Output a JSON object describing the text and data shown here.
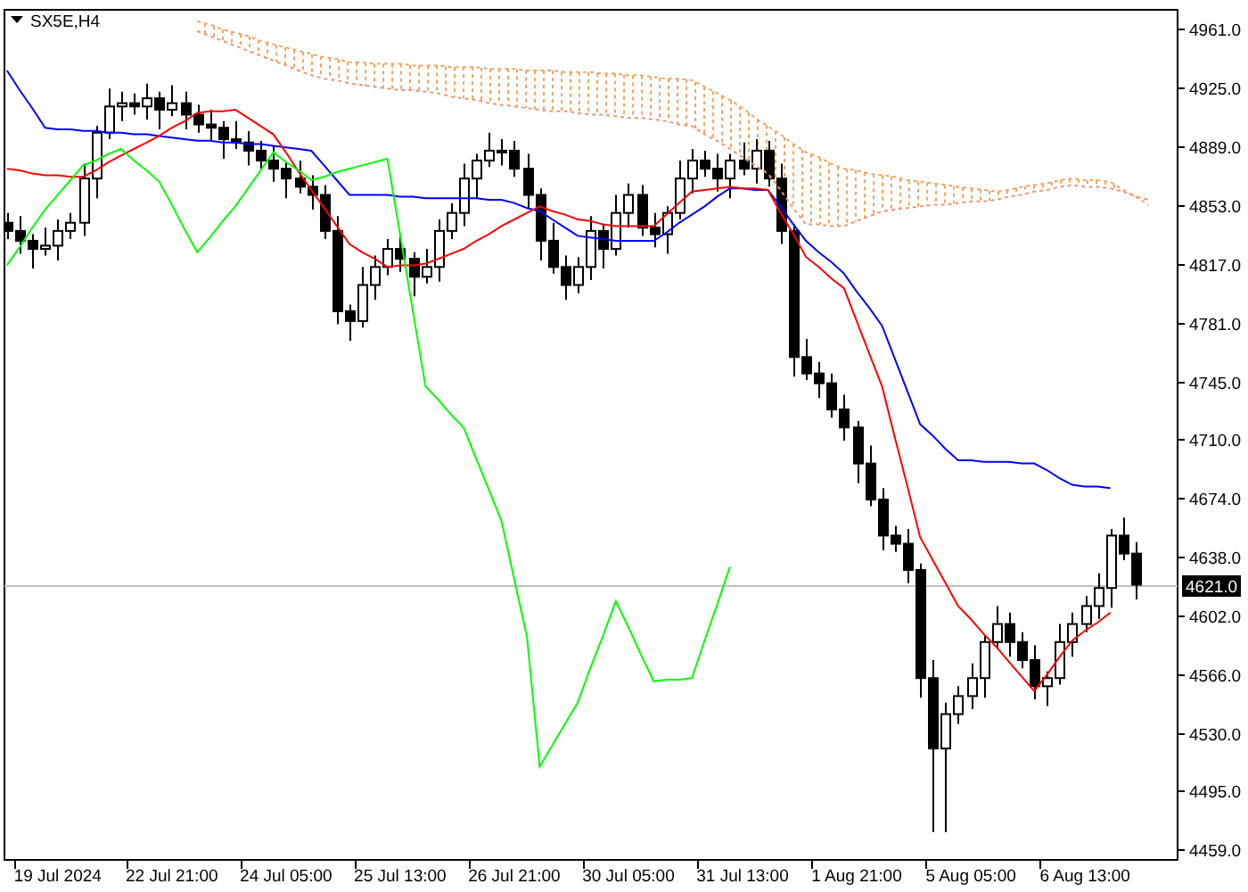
{
  "chart": {
    "symbol": "SX5E,H4",
    "chart_data": {
      "type": "candlestick",
      "categories": [
        null,
        null,
        null,
        null,
        "19 Jul 2024",
        null,
        null,
        null,
        null,
        null,
        null,
        null,
        null,
        "22 Jul 21:00",
        null,
        null,
        null,
        null,
        null,
        null,
        null,
        null,
        "24 Jul 05:00",
        null,
        null,
        null,
        null,
        null,
        null,
        null,
        null,
        "25 Jul 13:00",
        null,
        null,
        null,
        null,
        null,
        null,
        null,
        null,
        "26 Jul 21:00",
        null,
        null,
        null,
        null,
        null,
        null,
        null,
        null,
        "30 Jul 05:00",
        null,
        null,
        null,
        null,
        null,
        null,
        null,
        null,
        "31 Jul 13:00",
        null,
        null,
        null,
        null,
        null,
        null,
        null,
        null,
        "1 Aug 21:00",
        null,
        null,
        null,
        null,
        null,
        null,
        null,
        null,
        "5 Aug 05:00",
        null,
        null,
        null,
        null,
        null,
        null,
        null,
        null,
        "6 Aug 13:00",
        null,
        null,
        null,
        null,
        null
      ],
      "ylim": [
        4453,
        4972
      ],
      "ref_lines": [
        {
          "axis": "y",
          "value": 4621,
          "label": "4621.0",
          "color": "#c0c0c0"
        }
      ],
      "yticks": [
        {
          "value": 4961,
          "label": "4961.0"
        },
        {
          "value": 4925,
          "label": "4925.0"
        },
        {
          "value": 4889,
          "label": "4889.0"
        },
        {
          "value": 4853,
          "label": "4853.0"
        },
        {
          "value": 4817,
          "label": "4817.0"
        },
        {
          "value": 4781,
          "label": "4781.0"
        },
        {
          "value": 4745,
          "label": "4745.0"
        },
        {
          "value": 4710,
          "label": "4710.0"
        },
        {
          "value": 4674,
          "label": "4674.0"
        },
        {
          "value": 4638,
          "label": "4638.0"
        },
        {
          "value": 4602,
          "label": "4602.0"
        },
        {
          "value": 4566,
          "label": "4566.0"
        },
        {
          "value": 4530,
          "label": "4530.0"
        },
        {
          "value": 4495,
          "label": "4495.0"
        },
        {
          "value": 4459,
          "label": "4459.0"
        }
      ],
      "ohlc": [
        [
          4842,
          4848,
          4832,
          4837
        ],
        [
          4837,
          4846,
          4823,
          4831
        ],
        [
          4831,
          4835,
          4814,
          4826
        ],
        [
          4826,
          4839,
          4822,
          4828
        ],
        [
          4828,
          4844,
          4819,
          4837
        ],
        [
          4837,
          4848,
          4832,
          4842
        ],
        [
          4842,
          4878,
          4834,
          4869
        ],
        [
          4869,
          4901,
          4857,
          4897
        ],
        [
          4897,
          4924,
          4893,
          4913
        ],
        [
          4913,
          4922,
          4904,
          4915
        ],
        [
          4915,
          4921,
          4908,
          4913
        ],
        [
          4913,
          4927,
          4905,
          4918
        ],
        [
          4918,
          4922,
          4899,
          4911
        ],
        [
          4911,
          4926,
          4907,
          4915
        ],
        [
          4915,
          4922,
          4899,
          4908
        ],
        [
          4908,
          4914,
          4897,
          4902
        ],
        [
          4902,
          4911,
          4892,
          4900
        ],
        [
          4900,
          4904,
          4881,
          4893
        ],
        [
          4893,
          4904,
          4887,
          4891
        ],
        [
          4891,
          4898,
          4877,
          4886
        ],
        [
          4886,
          4892,
          4875,
          4880
        ],
        [
          4880,
          4889,
          4867,
          4875
        ],
        [
          4875,
          4879,
          4857,
          4869
        ],
        [
          4869,
          4880,
          4860,
          4864
        ],
        [
          4864,
          4871,
          4850,
          4859
        ],
        [
          4859,
          4865,
          4832,
          4837
        ],
        [
          4837,
          4846,
          4780,
          4788
        ],
        [
          4788,
          4792,
          4770,
          4782
        ],
        [
          4782,
          4815,
          4778,
          4804
        ],
        [
          4804,
          4822,
          4795,
          4815
        ],
        [
          4815,
          4832,
          4810,
          4826
        ],
        [
          4826,
          4835,
          4812,
          4820
        ],
        [
          4820,
          4824,
          4797,
          4809
        ],
        [
          4809,
          4826,
          4805,
          4815
        ],
        [
          4815,
          4844,
          4806,
          4837
        ],
        [
          4837,
          4854,
          4832,
          4848
        ],
        [
          4848,
          4878,
          4840,
          4869
        ],
        [
          4869,
          4884,
          4857,
          4880
        ],
        [
          4880,
          4897,
          4876,
          4886
        ],
        [
          4886,
          4893,
          4877,
          4886
        ],
        [
          4886,
          4892,
          4870,
          4875
        ],
        [
          4875,
          4884,
          4851,
          4859
        ],
        [
          4859,
          4863,
          4819,
          4831
        ],
        [
          4831,
          4842,
          4811,
          4815
        ],
        [
          4815,
          4822,
          4795,
          4804
        ],
        [
          4804,
          4821,
          4799,
          4815
        ],
        [
          4815,
          4846,
          4807,
          4837
        ],
        [
          4837,
          4841,
          4814,
          4826
        ],
        [
          4826,
          4859,
          4822,
          4848
        ],
        [
          4848,
          4866,
          4839,
          4859
        ],
        [
          4859,
          4865,
          4834,
          4839
        ],
        [
          4839,
          4848,
          4827,
          4835
        ],
        [
          4835,
          4852,
          4823,
          4848
        ],
        [
          4848,
          4880,
          4844,
          4869
        ],
        [
          4869,
          4887,
          4860,
          4880
        ],
        [
          4880,
          4886,
          4870,
          4875
        ],
        [
          4875,
          4884,
          4861,
          4869
        ],
        [
          4869,
          4884,
          4857,
          4880
        ],
        [
          4880,
          4891,
          4871,
          4875
        ],
        [
          4875,
          4893,
          4866,
          4886
        ],
        [
          4886,
          4892,
          4864,
          4869
        ],
        [
          4869,
          4878,
          4829,
          4837
        ],
        [
          4837,
          4841,
          4748,
          4760
        ],
        [
          4760,
          4771,
          4746,
          4750
        ],
        [
          4750,
          4757,
          4735,
          4744
        ],
        [
          4744,
          4750,
          4723,
          4728
        ],
        [
          4728,
          4737,
          4709,
          4717
        ],
        [
          4717,
          4721,
          4683,
          4695
        ],
        [
          4695,
          4706,
          4669,
          4673
        ],
        [
          4673,
          4680,
          4642,
          4651
        ],
        [
          4651,
          4657,
          4641,
          4646
        ],
        [
          4646,
          4655,
          4622,
          4630
        ],
        [
          4630,
          4634,
          4552,
          4564
        ],
        [
          4564,
          4575,
          4470,
          4521
        ],
        [
          4521,
          4549,
          4470,
          4542
        ],
        [
          4542,
          4559,
          4536,
          4553
        ],
        [
          4553,
          4573,
          4545,
          4564
        ],
        [
          4564,
          4590,
          4552,
          4586
        ],
        [
          4586,
          4608,
          4582,
          4597
        ],
        [
          4597,
          4604,
          4577,
          4586
        ],
        [
          4586,
          4592,
          4570,
          4575
        ],
        [
          4575,
          4584,
          4551,
          4559
        ],
        [
          4559,
          4568,
          4547,
          4564
        ],
        [
          4564,
          4597,
          4560,
          4586
        ],
        [
          4586,
          4604,
          4577,
          4597
        ],
        [
          4597,
          4614,
          4592,
          4608
        ],
        [
          4608,
          4628,
          4600,
          4619
        ],
        [
          4619,
          4655,
          4607,
          4651
        ],
        [
          4651,
          4662,
          4636,
          4640
        ],
        [
          4640,
          4647,
          4612,
          4621
        ],
        null
      ],
      "series": [
        {
          "type": "line",
          "color": "#f4a460",
          "line_style": "dashed",
          "values": [
            null,
            null,
            null,
            null,
            null,
            null,
            null,
            null,
            null,
            null,
            null,
            null,
            null,
            null,
            null,
            4965,
            4963,
            4960,
            4958,
            4956,
            4953,
            4951,
            4949,
            4947,
            4945,
            4943,
            4942,
            4940,
            4940,
            4939,
            4939,
            4939,
            4938,
            4938,
            4938,
            4937,
            4937,
            4937,
            4936,
            4936,
            4936,
            4935,
            4935,
            4935,
            4934,
            4934,
            4934,
            4933,
            4933,
            4932,
            4932,
            4931,
            4930,
            4930,
            4929,
            4925,
            4921,
            4917,
            4912,
            4906,
            4901,
            4896,
            4890,
            4885,
            4882,
            4878,
            4875,
            4874,
            4872,
            4871,
            4870,
            4868,
            4867,
            4866,
            4865,
            4864,
            4863,
            4862,
            4861,
            4862,
            4864,
            4865,
            4866,
            4868,
            4869,
            4868,
            4868,
            4867,
            4862,
            4858,
            4853
          ]
        },
        {
          "type": "line",
          "color": "#e9967a",
          "line_style": "dashed",
          "values": [
            null,
            null,
            null,
            null,
            null,
            null,
            null,
            null,
            null,
            null,
            null,
            null,
            null,
            null,
            null,
            4959,
            4956,
            4953,
            4950,
            4947,
            4944,
            4941,
            4938,
            4935,
            4932,
            4930,
            4929,
            4927,
            4926,
            4925,
            4924,
            4923,
            4923,
            4922,
            4921,
            4919,
            4918,
            4917,
            4915,
            4914,
            4913,
            4912,
            4911,
            4910,
            4910,
            4909,
            4908,
            4908,
            4907,
            4906,
            4906,
            4905,
            4904,
            4902,
            4901,
            4896,
            4892,
            4887,
            4882,
            4877,
            4872,
            4862,
            4851,
            4841,
            4841,
            4840,
            4840,
            4843,
            4846,
            4849,
            4850,
            4851,
            4852,
            4853,
            4853,
            4854,
            4855,
            4855,
            4856,
            4858,
            4859,
            4861,
            4862,
            4864,
            4865,
            4864,
            4864,
            4863,
            4861,
            4858,
            4856
          ]
        },
        {
          "type": "line",
          "color": "#0000ff",
          "values": [
            4935,
            4923,
            4912,
            4900,
            4899,
            4899,
            4898,
            4898,
            4897,
            4897,
            4896,
            4896,
            4895,
            4894,
            4893,
            4892,
            4892,
            4891,
            4891,
            4890,
            4890,
            4889,
            4888,
            4887,
            4886,
            4877,
            4868,
            4859,
            4859,
            4859,
            4859,
            4858,
            4858,
            4857,
            4857,
            4857,
            4857,
            4857,
            4856,
            4856,
            4854,
            4851,
            4849,
            4844,
            4839,
            4834,
            4833,
            4832,
            4831,
            4831,
            4831,
            4831,
            4836,
            4842,
            4847,
            4852,
            4858,
            4863,
            4863,
            4862,
            4862,
            4852,
            4841,
            4831,
            4824,
            4818,
            4811,
            4800,
            4790,
            4779,
            4759,
            4739,
            4719,
            4712,
            4704,
            4697,
            4697,
            4696,
            4696,
            4696,
            4695,
            4695,
            4691,
            4686,
            4682,
            4681,
            4681,
            4680,
            null,
            null,
            null
          ]
        },
        {
          "type": "line",
          "color": "#ff0000",
          "values": [
            4875,
            4874,
            4872,
            4871,
            4871,
            4870,
            4870,
            4874,
            4879,
            4883,
            4887,
            4891,
            4895,
            4900,
            4904,
            4909,
            4910,
            4910,
            4911,
            4906,
            4901,
            4896,
            4885,
            4873,
            4862,
            4851,
            4840,
            4829,
            4824,
            4820,
            4815,
            4816,
            4816,
            4817,
            4820,
            4823,
            4826,
            4831,
            4835,
            4840,
            4844,
            4848,
            4852,
            4849,
            4847,
            4844,
            4843,
            4841,
            4840,
            4840,
            4840,
            4840,
            4847,
            4854,
            4861,
            4862,
            4863,
            4864,
            4863,
            4863,
            4862,
            4848,
            4835,
            4821,
            4815,
            4808,
            4802,
            4782,
            4762,
            4742,
            4711,
            4681,
            4650,
            4636,
            4622,
            4608,
            4600,
            4591,
            4583,
            4574,
            4565,
            4556,
            4566,
            4577,
            4587,
            4593,
            4598,
            4604,
            null,
            null,
            null
          ]
        },
        {
          "type": "line",
          "color": "#00ff00",
          "values": [
            4816,
            4827,
            4839,
            4850,
            4859,
            4868,
            4877,
            4880,
            4884,
            4887,
            4880,
            4874,
            4867,
            4853,
            4838,
            4824,
            4833,
            4843,
            4852,
            4863,
            4874,
            4885,
            4879,
            4874,
            4868,
            4870,
            4873,
            4875,
            4877,
            4879,
            4881,
            4835,
            4788,
            4742,
            4734,
            4725,
            4717,
            4698,
            4679,
            4660,
            4624,
            4589,
            4510,
            4523,
            4536,
            4549,
            4570,
            4590,
            4611,
            4595,
            4578,
            4562,
            4563,
            4563,
            4564,
            4587,
            4609,
            4632,
            null,
            null,
            null,
            null,
            null,
            null,
            null,
            null,
            null,
            null,
            null,
            null,
            null,
            null,
            null,
            null,
            null,
            null,
            null,
            null,
            null,
            null,
            null,
            null,
            null,
            null,
            null,
            null,
            null,
            null,
            null,
            null,
            null
          ]
        }
      ]
    }
  }
}
